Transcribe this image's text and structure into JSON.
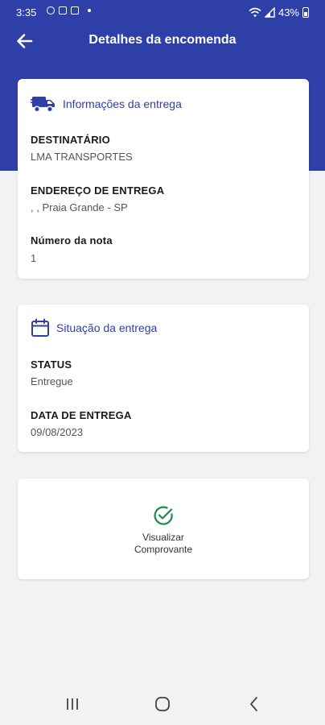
{
  "status_bar": {
    "time": "3:35",
    "battery": "43%",
    "icons": [
      "whatsapp-icon",
      "image-icon",
      "app-icon",
      "wifi-icon",
      "signal-icon",
      "battery-icon"
    ]
  },
  "appbar": {
    "title": "Detalhes da encomenda",
    "back_icon": "arrow-left-icon"
  },
  "delivery_info": {
    "heading": "Informações da entrega",
    "icon": "truck-icon",
    "recipient_label": "DESTINATÁRIO",
    "recipient_value": "LMA TRANSPORTES",
    "address_label": "ENDEREÇO DE ENTREGA",
    "address_value": ", , Praia Grande - SP",
    "invoice_label": "Número da nota",
    "invoice_value": "1"
  },
  "delivery_status": {
    "heading": "Situação da entrega",
    "icon": "calendar-icon",
    "status_label": "STATUS",
    "status_value": "Entregue",
    "date_label": "DATA DE ENTREGA",
    "date_value": "09/08/2023"
  },
  "proof": {
    "icon": "check-circle-icon",
    "line1": "Visualizar",
    "line2": "Comprovante"
  },
  "colors": {
    "primary": "#2f3fa8",
    "success": "#1e8a4c",
    "background": "#f2f2f4"
  },
  "nav_bar": {
    "icons": [
      "recent-apps-icon",
      "home-icon",
      "back-icon"
    ]
  }
}
